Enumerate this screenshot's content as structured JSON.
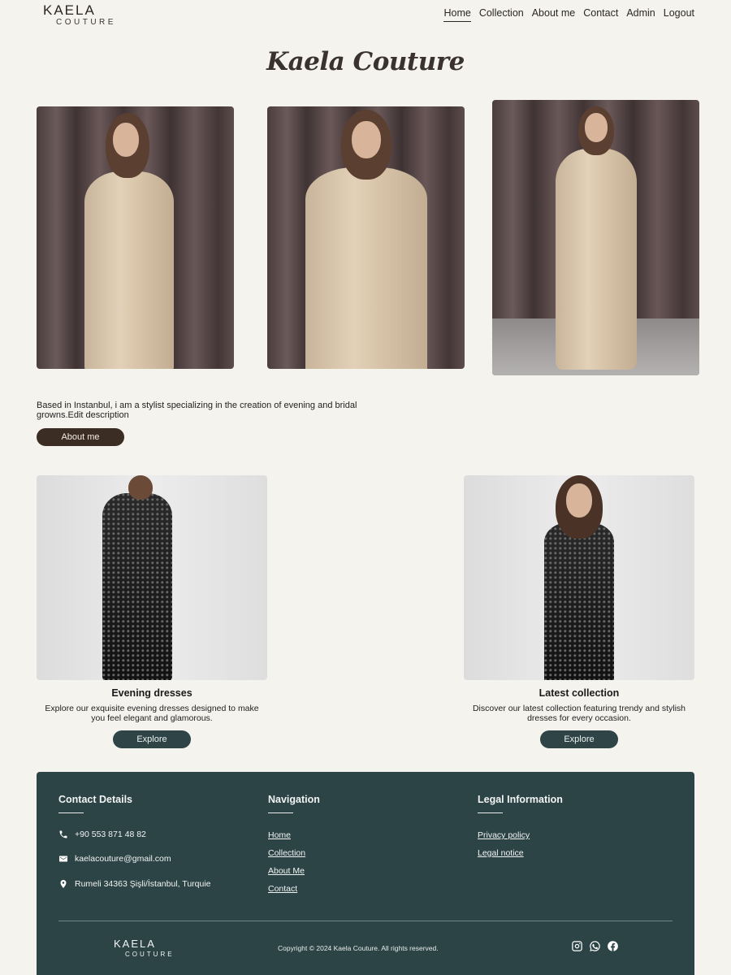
{
  "header": {
    "logo_line1": "KAELA",
    "logo_line2": "COUTURE",
    "nav": [
      {
        "label": "Home"
      },
      {
        "label": "Collection"
      },
      {
        "label": "About me"
      },
      {
        "label": "Contact"
      },
      {
        "label": "Admin"
      },
      {
        "label": "Logout"
      }
    ]
  },
  "title": "Kaela Couture",
  "intro": {
    "text": "Based in Instanbul, i am a stylist specializing in the creation of evening and bridal growns.Edit description",
    "button": "About me"
  },
  "cards": [
    {
      "title": "Evening dresses",
      "description": "Explore our exquisite evening dresses designed to make you feel elegant and glamorous.",
      "button": "Explore"
    },
    {
      "title": "Latest collection",
      "description": "Discover our latest collection featuring trendy and stylish dresses for every occasion.",
      "button": "Explore"
    }
  ],
  "footer": {
    "contact": {
      "heading": "Contact Details",
      "phone": "+90 553 871 48 82",
      "email": "kaelacouture@gmail.com",
      "address": "Rumeli 34363 Şişli/İstanbul, Turquie"
    },
    "navigation": {
      "heading": "Navigation",
      "links": [
        "Home",
        "Collection",
        "About Me",
        "Contact"
      ]
    },
    "legal": {
      "heading": "Legal Information",
      "links": [
        "Privacy policy",
        "Legal notice"
      ]
    },
    "logo_line1": "KAELA",
    "logo_line2": "COUTURE",
    "copyright": "Copyright © 2024 Kaela Couture. All rights reserved.",
    "social_icons": [
      "instagram-icon",
      "whatsapp-icon",
      "facebook-icon"
    ]
  },
  "colors": {
    "background": "#f5f3ee",
    "footer": "#2d4446",
    "about_button": "#3b2d24",
    "explore_button": "#2e4446"
  }
}
